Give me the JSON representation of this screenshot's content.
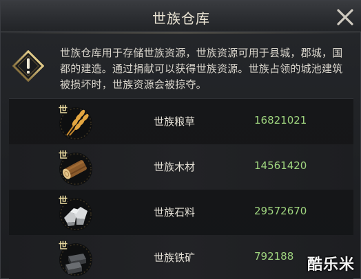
{
  "window": {
    "title": "世族仓库"
  },
  "notice": {
    "icon": "warning-icon",
    "text": "世族仓库用于存储世族资源，世族资源可用于县城，郡城，国都的建造。通过捐献可以获得世族资源。世族占领的城池建筑被损坏时，世族资源会被掠夺。"
  },
  "resources": [
    {
      "badge": "世",
      "name": "世族粮草",
      "amount": "16821021",
      "icon": "grain-icon"
    },
    {
      "badge": "世",
      "name": "世族木材",
      "amount": "14561420",
      "icon": "wood-icon"
    },
    {
      "badge": "世",
      "name": "世族石料",
      "amount": "29572670",
      "icon": "stone-icon"
    },
    {
      "badge": "世",
      "name": "世族铁矿",
      "amount": "792188",
      "icon": "iron-icon"
    }
  ],
  "watermark": "酷乐米",
  "colors": {
    "amount": "#9fd57f",
    "title": "#e8e2d2",
    "accent_gold": "#c9a24a"
  }
}
